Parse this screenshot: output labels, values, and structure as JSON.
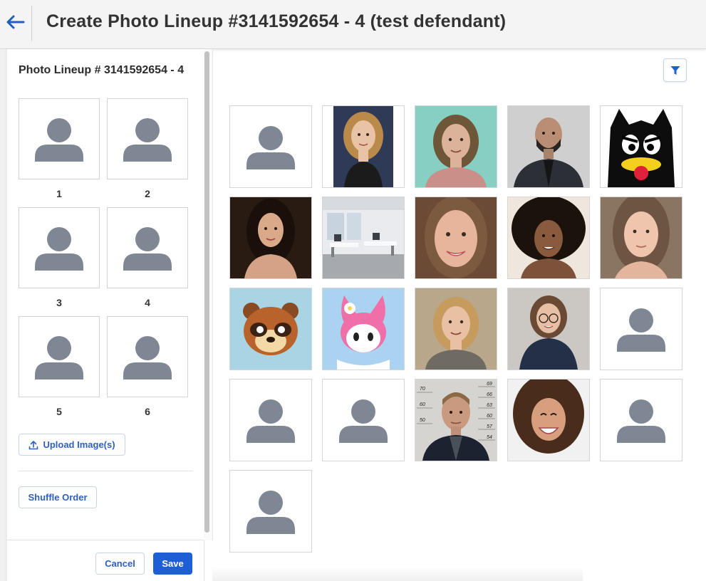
{
  "header": {
    "title": "Create Photo Lineup #3141592654 - 4 (test defendant)",
    "back_icon": "arrow-left-icon"
  },
  "lineup": {
    "title": "Photo Lineup # 3141592654 - 4",
    "slots": [
      {
        "number": "1"
      },
      {
        "number": "2"
      },
      {
        "number": "3"
      },
      {
        "number": "4"
      },
      {
        "number": "5"
      },
      {
        "number": "6"
      }
    ],
    "upload_label": "Upload Image(s)",
    "shuffle_label": "Shuffle Order"
  },
  "footer": {
    "cancel_label": "Cancel",
    "save_label": "Save"
  },
  "gallery": {
    "filter_icon": "filter-icon",
    "accent_color": "#1f5fd6",
    "photos": [
      {
        "kind": "placeholder"
      },
      {
        "kind": "photo",
        "subject": "woman-curly-hair"
      },
      {
        "kind": "photo",
        "subject": "woman-mugshot"
      },
      {
        "kind": "photo",
        "subject": "man-leather-jacket"
      },
      {
        "kind": "photo",
        "subject": "cartoon-black-cat"
      },
      {
        "kind": "photo",
        "subject": "woman-dark-hair"
      },
      {
        "kind": "photo",
        "subject": "office-interior"
      },
      {
        "kind": "photo",
        "subject": "woman-smiling"
      },
      {
        "kind": "photo",
        "subject": "woman-curly-afro"
      },
      {
        "kind": "photo",
        "subject": "young-woman"
      },
      {
        "kind": "photo",
        "subject": "cartoon-raccoon"
      },
      {
        "kind": "photo",
        "subject": "cartoon-bunny"
      },
      {
        "kind": "photo",
        "subject": "woman-outdoors"
      },
      {
        "kind": "photo",
        "subject": "woman-glasses"
      },
      {
        "kind": "placeholder"
      },
      {
        "kind": "placeholder"
      },
      {
        "kind": "placeholder"
      },
      {
        "kind": "photo",
        "subject": "man-mugshot-height-chart"
      },
      {
        "kind": "photo",
        "subject": "woman-laughing"
      },
      {
        "kind": "placeholder"
      },
      {
        "kind": "placeholder"
      }
    ],
    "mugshot_height_marks": [
      "69",
      "66",
      "63",
      "60",
      "57",
      "54",
      "70",
      "60",
      "50"
    ]
  }
}
